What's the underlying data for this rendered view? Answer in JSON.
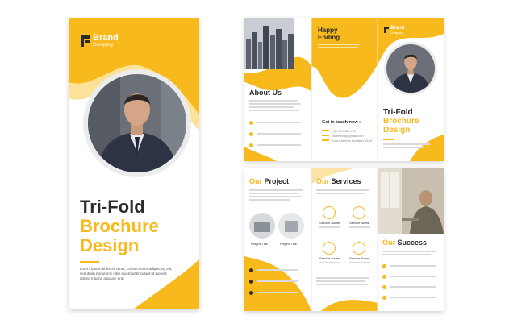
{
  "colors": {
    "accent": "#f7b91b",
    "dark": "#2b2b2b",
    "photo_dark": "#3a3f47"
  },
  "cover": {
    "brand_name": "Brand",
    "brand_sub": "Company",
    "title_line1": "Tri-Fold",
    "title_line2": "Brochure",
    "title_line3": "Design",
    "body": "Lorem ipsum dolor sit amet, consectetuer adipiscing elit, sed diam nonummy nibh euismod tincidunt ut laoreet dolore magna aliquam erat"
  },
  "outside": {
    "happy": "Happy",
    "ending": "Ending",
    "about_title": "About Us",
    "get_in_touch": "Get in touch now :",
    "phone": "+88 123 456 789",
    "email": "youremail@gmail.com",
    "address": "Your Address Location 1234",
    "brand_name": "Brand",
    "brand_sub": "Company",
    "title_line1": "Tri-Fold",
    "title_line2": "Brochure",
    "title_line3": "Design"
  },
  "inside": {
    "our_project": "Our Project",
    "our_services": "Our Services",
    "our_success": "Our Success",
    "project_title_1": "Project Title",
    "project_title_2": "Project Title",
    "service_1": "Service Name",
    "service_2": "Service Name",
    "service_3": "Service Name",
    "service_4": "Service Name"
  }
}
